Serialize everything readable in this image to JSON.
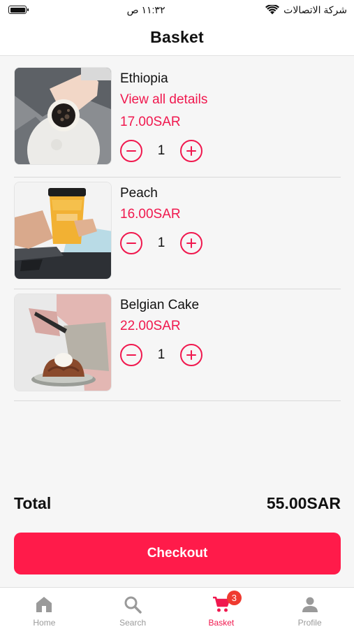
{
  "status_bar": {
    "carrier": "شركة الاتصالات",
    "time": "١١:٣٢ ص"
  },
  "header": {
    "title": "Basket"
  },
  "items": [
    {
      "name": "Ethiopia",
      "details_link": "View all details",
      "price": "17.00SAR",
      "quantity": "1",
      "image": "coffee-cup-top-view"
    },
    {
      "name": "Peach",
      "price": "16.00SAR",
      "quantity": "1",
      "image": "iced-peach-drink"
    },
    {
      "name": "Belgian Cake",
      "price": "22.00SAR",
      "quantity": "1",
      "image": "lava-cake"
    }
  ],
  "total": {
    "label": "Total",
    "value": "55.00SAR"
  },
  "checkout": {
    "label": "Checkout"
  },
  "tabs": [
    {
      "label": "Home",
      "icon": "home-icon"
    },
    {
      "label": "Search",
      "icon": "search-icon"
    },
    {
      "label": "Basket",
      "icon": "cart-icon",
      "badge": "3",
      "active": true
    },
    {
      "label": "Profile",
      "icon": "profile-icon"
    }
  ],
  "colors": {
    "accent": "#f0184e",
    "checkout_bg": "#ff1b4a",
    "badge": "#ef3b30"
  }
}
